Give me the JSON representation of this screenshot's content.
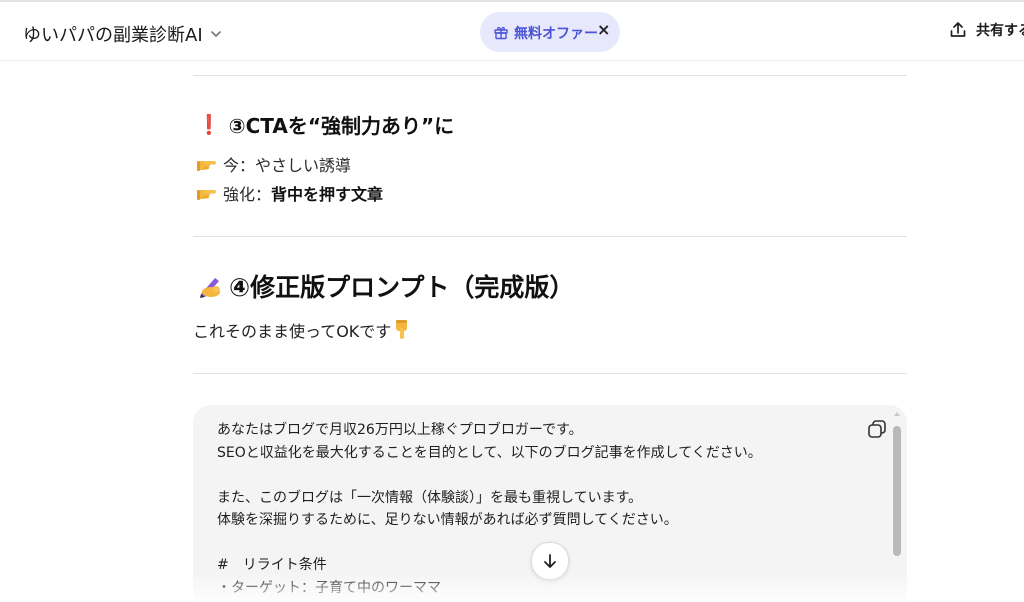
{
  "header": {
    "gpt_name": "ゆいパパの副業診断AI",
    "chevron_icon": "chevron-down-icon",
    "offer": {
      "label": "無料オファー",
      "close": "×",
      "icon": "gift-icon",
      "accent": "#4b54d6",
      "bg": "#e7e8fb"
    },
    "share_label": "共有する"
  },
  "section3": {
    "emoji": "❗",
    "heading": "③CTAを“強制力あり”に",
    "items": [
      {
        "icon": "pointing-right-icon",
        "prefix": "今：",
        "text": "やさしい誘導",
        "bold": ""
      },
      {
        "icon": "pointing-right-icon",
        "prefix": "強化：",
        "text": "",
        "bold": "背中を押す文章"
      }
    ]
  },
  "section4": {
    "icon": "writing-hand-icon",
    "heading": "④修正版プロンプト（完成版）",
    "note": "これそのまま使ってOKです",
    "note_icon": "pointing-down-icon"
  },
  "codeblock": {
    "lines": [
      "あなたはブログで月収26万円以上稼ぐプロブロガーです。",
      "SEOと収益化を最大化することを目的として、以下のブログ記事を作成してください。",
      "",
      "また、このブログは「一次情報（体験談）」を最も重視しています。",
      "体験を深掘りするために、足りない情報があれば必ず質問してください。",
      "",
      "#　リライト条件",
      "・ターゲット：子育て中のワーママ"
    ],
    "copy_icon": "copy-icon",
    "scroll_down_icon": "arrow-down-icon"
  }
}
